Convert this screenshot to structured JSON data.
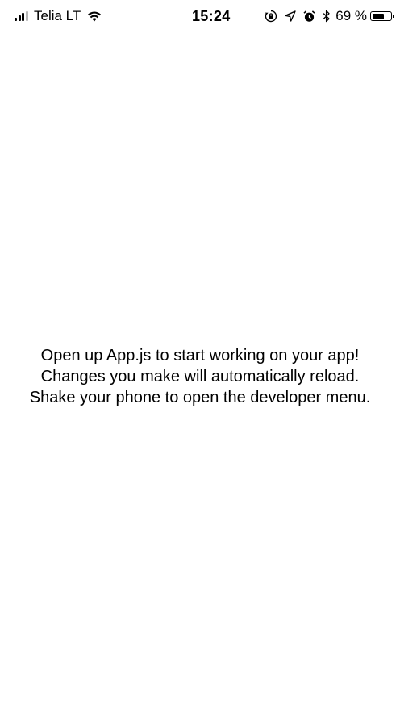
{
  "status_bar": {
    "signal_bars": 4,
    "signal_bars_filled": 3,
    "carrier": "Telia LT",
    "time": "15:24",
    "battery_text": "69 %",
    "battery_level": 0.69,
    "icons": [
      "signal-icon",
      "wifi-icon",
      "orientation-lock-icon",
      "location-icon",
      "alarm-icon",
      "bluetooth-icon",
      "battery-icon"
    ]
  },
  "main": {
    "lines": [
      "Open up App.js to start working on your app!",
      "Changes you make will automatically reload.",
      "Shake your phone to open the developer menu."
    ]
  },
  "colors": {
    "background": "#ffffff",
    "text": "#000000"
  }
}
